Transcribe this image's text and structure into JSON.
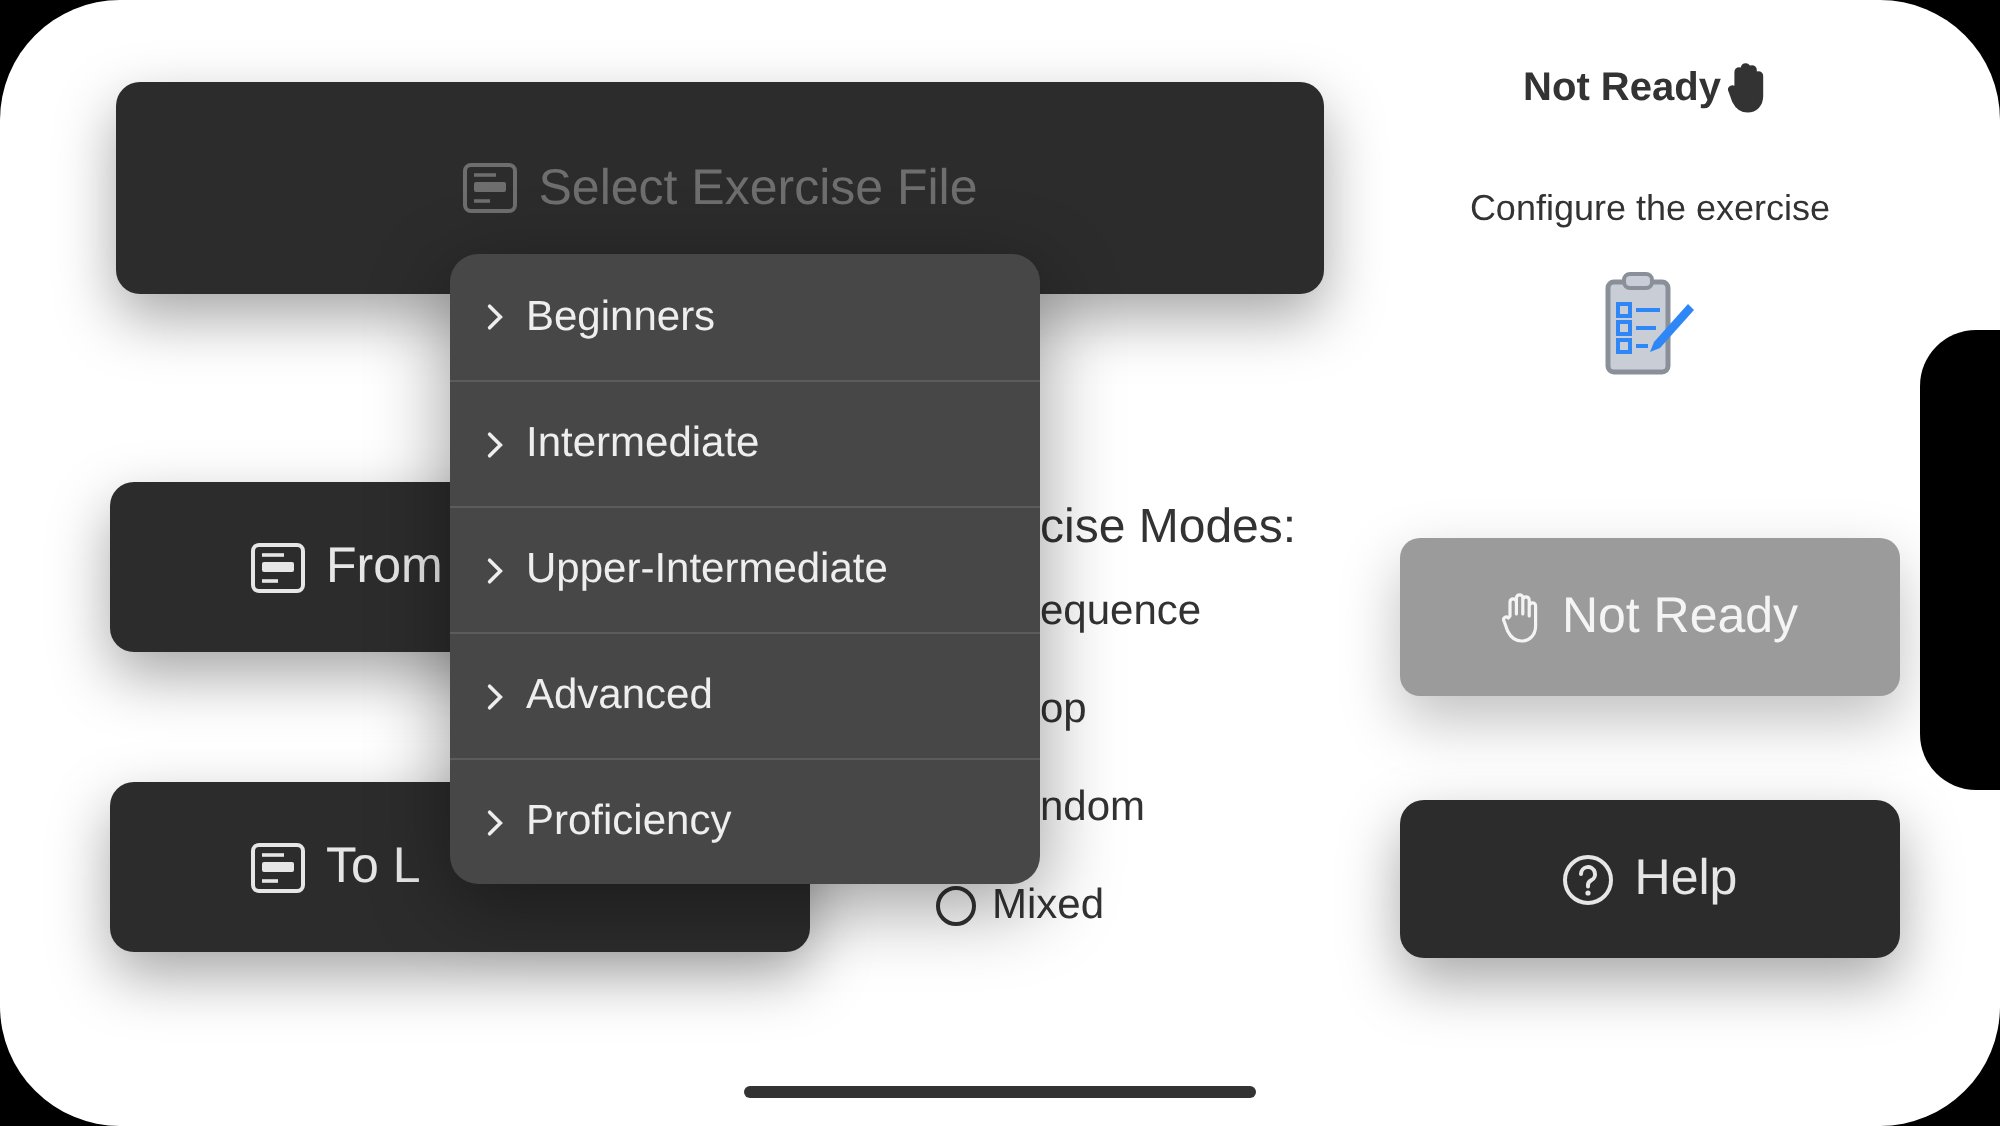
{
  "select_file_button": {
    "label": "Select Exercise File",
    "disabled": true
  },
  "language_buttons": [
    {
      "label": "From"
    },
    {
      "label": "To L"
    }
  ],
  "exercise_modes": {
    "title": "cise Modes:",
    "options": [
      {
        "kind": "partial",
        "label": "equence"
      },
      {
        "kind": "partial",
        "label": "op"
      },
      {
        "kind": "partial",
        "label": "ndom"
      },
      {
        "kind": "radio",
        "label": "Mixed",
        "selected": false
      }
    ]
  },
  "level_menu": {
    "items": [
      {
        "label": "Beginners"
      },
      {
        "label": "Intermediate"
      },
      {
        "label": "Upper-Intermediate"
      },
      {
        "label": "Advanced"
      },
      {
        "label": "Proficiency"
      }
    ]
  },
  "status": {
    "title": "Not Ready",
    "message": "Configure the exercise"
  },
  "ready_button": {
    "label": "Not Ready",
    "disabled": true
  },
  "help_button": {
    "label": "Help"
  }
}
